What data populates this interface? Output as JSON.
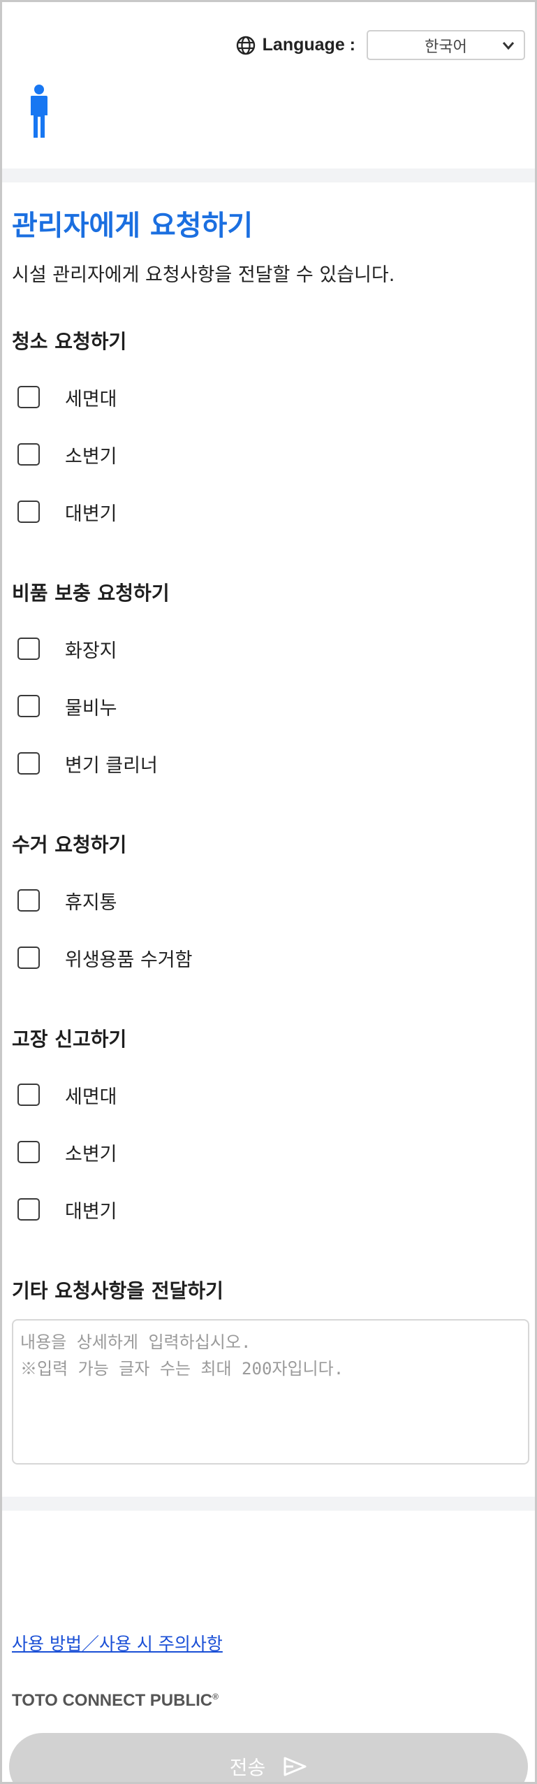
{
  "header": {
    "language_label": "Language :",
    "language_value": "한국어"
  },
  "main": {
    "title": "관리자에게 요청하기",
    "description": "시설 관리자에게 요청사항을 전달할 수 있습니다.",
    "sections": [
      {
        "title": "청소 요청하기",
        "items": [
          "세면대",
          "소변기",
          "대변기"
        ]
      },
      {
        "title": "비품 보충 요청하기",
        "items": [
          "화장지",
          "물비누",
          "변기 클리너"
        ]
      },
      {
        "title": "수거 요청하기",
        "items": [
          "휴지통",
          "위생용품 수거함"
        ]
      },
      {
        "title": "고장 신고하기",
        "items": [
          "세면대",
          "소변기",
          "대변기"
        ]
      }
    ],
    "other": {
      "title": "기타 요청사항을 전달하기",
      "placeholder": "내용을 상세하게 입력하십시오.\n※입력 가능 글자 수는 최대 200자입니다."
    }
  },
  "footer": {
    "help_link": "사용 방법／사용 시 주의사항",
    "brand": "TOTO CONNECT PUBLIC",
    "brand_mark": "®",
    "send_label": "전송"
  },
  "icons": {
    "globe": "globe-icon",
    "person": "person-icon",
    "chevron": "chevron-down-icon",
    "send": "send-icon"
  },
  "colors": {
    "accent": "#1b6fe0",
    "person": "#1877f2",
    "link": "#1a4fd6",
    "button_disabled": "#d2d2d2"
  }
}
